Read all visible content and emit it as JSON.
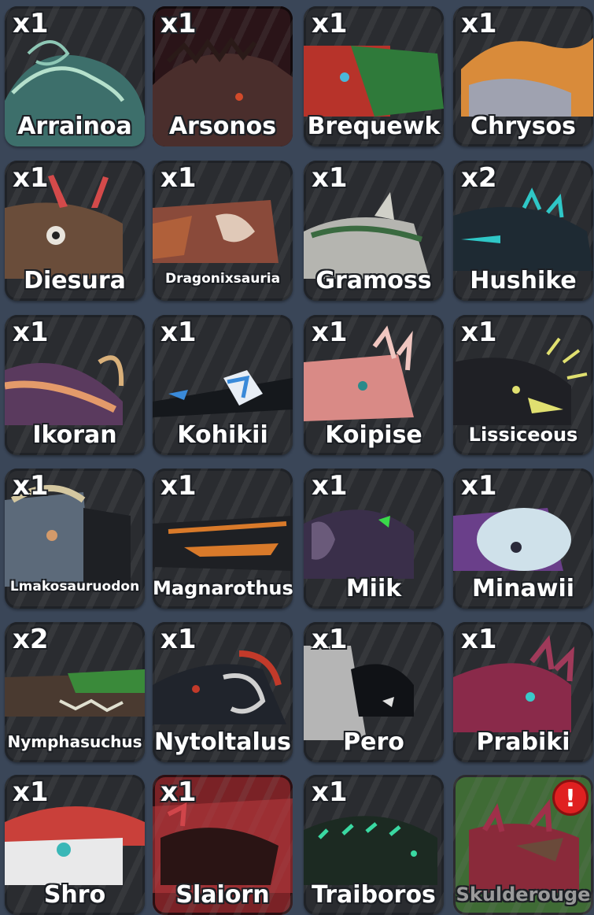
{
  "inventory": {
    "items": [
      {
        "count": "x1",
        "name": "Arrainoa",
        "color": "#4f8e86",
        "accent": "#b5e0cc"
      },
      {
        "count": "x1",
        "name": "Arsonos",
        "color": "#4a2e2c",
        "accent": "#d24a2a"
      },
      {
        "count": "x1",
        "name": "Brequewk",
        "color": "#b7332a",
        "accent": "#2f7a3a"
      },
      {
        "count": "x1",
        "name": "Chrysos",
        "color": "#d98b3a",
        "accent": "#9fa2b0"
      },
      {
        "count": "x1",
        "name": "Diesura",
        "color": "#6a4d3a",
        "accent": "#d44a4a"
      },
      {
        "count": "x1",
        "name": "Dragonixsauria",
        "color": "#8a4a3a",
        "accent": "#e0c9b8"
      },
      {
        "count": "x1",
        "name": "Gramoss",
        "color": "#b5b5b0",
        "accent": "#3a6a40"
      },
      {
        "count": "x2",
        "name": "Hushike",
        "color": "#1e2a33",
        "accent": "#2fc7c7"
      },
      {
        "count": "x1",
        "name": "Ikoran",
        "color": "#5a3a5e",
        "accent": "#e39a6a"
      },
      {
        "count": "x1",
        "name": "Kohikii",
        "color": "#15181c",
        "accent": "#3a8ad9"
      },
      {
        "count": "x1",
        "name": "Koipise",
        "color": "#d98a86",
        "accent": "#f0c6c0"
      },
      {
        "count": "x1",
        "name": "Lissiceous",
        "color": "#1f2025",
        "accent": "#e0e070"
      },
      {
        "count": "x1",
        "name": "Lmakosauruodon",
        "color": "#5c6a7a",
        "accent": "#d4c7a0"
      },
      {
        "count": "x1",
        "name": "Magnarothus",
        "color": "#1e2024",
        "accent": "#d97a2a"
      },
      {
        "count": "x1",
        "name": "Miik",
        "color": "#3a2f4a",
        "accent": "#3ad94a"
      },
      {
        "count": "x1",
        "name": "Minawii",
        "color": "#6a3f8a",
        "accent": "#cfe1ea"
      },
      {
        "count": "x2",
        "name": "Nymphasuchus",
        "color": "#4a3a30",
        "accent": "#3a8a3a"
      },
      {
        "count": "x1",
        "name": "Nytoltalus",
        "color": "#20242c",
        "accent": "#c23a2a"
      },
      {
        "count": "x1",
        "name": "Pero",
        "color": "#b5b5b5",
        "accent": "#101216"
      },
      {
        "count": "x1",
        "name": "Prabiki",
        "color": "#8a2a4a",
        "accent": "#3ac9c9"
      },
      {
        "count": "x1",
        "name": "Shro",
        "color": "#c9403a",
        "accent": "#e9e9ea"
      },
      {
        "count": "x1",
        "name": "Slaiorn",
        "color": "#2a1414",
        "accent": "#d0454a"
      },
      {
        "count": "x1",
        "name": "Traiboros",
        "color": "#1c2a22",
        "accent": "#3ad9a2"
      },
      {
        "count": "",
        "name": "Skulderouge",
        "color": "#8a2a3a",
        "accent": "#4a7a3a",
        "badge": "!"
      }
    ]
  }
}
